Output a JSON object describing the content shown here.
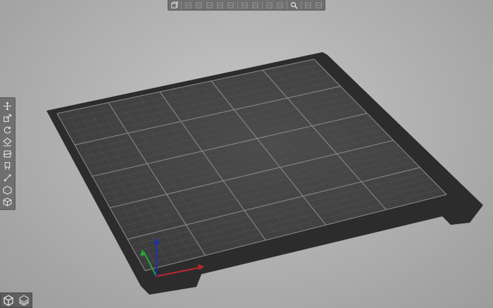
{
  "app": {
    "view": "3D editor view"
  },
  "top_toolbar": {
    "buttons": [
      {
        "icon": "add-object-icon",
        "active": true
      },
      {
        "icon": "delete-icon",
        "active": false
      },
      {
        "icon": "delete-all-icon",
        "active": false
      },
      {
        "icon": "arrange-icon",
        "active": false
      },
      {
        "icon": "copy-icon",
        "active": false
      },
      {
        "icon": "paste-icon",
        "active": false
      },
      {
        "icon": "add-instance-icon",
        "active": false
      },
      {
        "icon": "remove-instance-icon",
        "active": false
      },
      {
        "icon": "split-to-objects-icon",
        "active": false
      },
      {
        "icon": "split-to-parts-icon",
        "active": false
      },
      {
        "icon": "search-icon",
        "active": true
      },
      {
        "icon": "layer-editing-icon",
        "active": false
      },
      {
        "icon": "undo-icon",
        "active": false
      }
    ]
  },
  "left_toolbar": {
    "tools": [
      {
        "icon": "move-icon",
        "active": true
      },
      {
        "icon": "scale-icon",
        "active": true
      },
      {
        "icon": "rotate-icon",
        "active": true
      },
      {
        "icon": "place-on-face-icon",
        "active": true
      },
      {
        "icon": "cut-icon",
        "active": true
      },
      {
        "icon": "paint-supports-icon",
        "active": true
      },
      {
        "icon": "seam-painting-icon",
        "active": true
      },
      {
        "icon": "hollow-icon",
        "active": true
      },
      {
        "icon": "measure-icon",
        "active": true
      }
    ]
  },
  "view_toggle": {
    "buttons": [
      {
        "icon": "3d-view-icon",
        "active": true
      },
      {
        "icon": "preview-icon",
        "active": false
      }
    ]
  },
  "colors": {
    "background": "#b3b3b3",
    "bed_surface": "#3a3a3a",
    "bed_frame": "#2c2c2c",
    "grid_fine": "#555555",
    "grid_major": "#8f8f8f",
    "toolbar_bg": "#6f6f6f",
    "axis_x": "#c0262a",
    "axis_y": "#2aa43a",
    "axis_z": "#1c2fb0"
  }
}
